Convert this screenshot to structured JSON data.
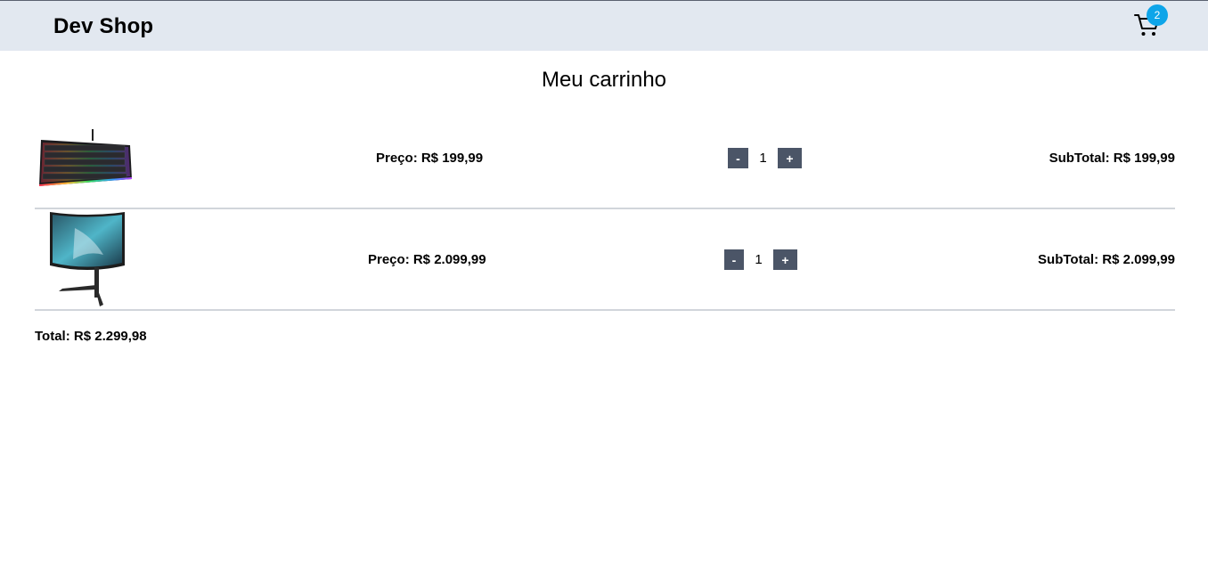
{
  "header": {
    "brand": "Dev Shop",
    "cart_count": "2"
  },
  "page": {
    "title": "Meu carrinho"
  },
  "cart": {
    "items": [
      {
        "name": "keyboard",
        "price_label": "Preço: R$ 199,99",
        "quantity": "1",
        "subtotal_label": "SubTotal: R$ 199,99",
        "decrease_label": "-",
        "increase_label": "+"
      },
      {
        "name": "monitor",
        "price_label": "Preço: R$ 2.099,99",
        "quantity": "1",
        "subtotal_label": "SubTotal: R$ 2.099,99",
        "decrease_label": "-",
        "increase_label": "+"
      }
    ],
    "total_label": "Total: R$ 2.299,98"
  },
  "colors": {
    "header_bg": "#e2e8f0",
    "badge": "#0ea5e9",
    "button": "#4b5567",
    "divider": "#d1d5db"
  }
}
